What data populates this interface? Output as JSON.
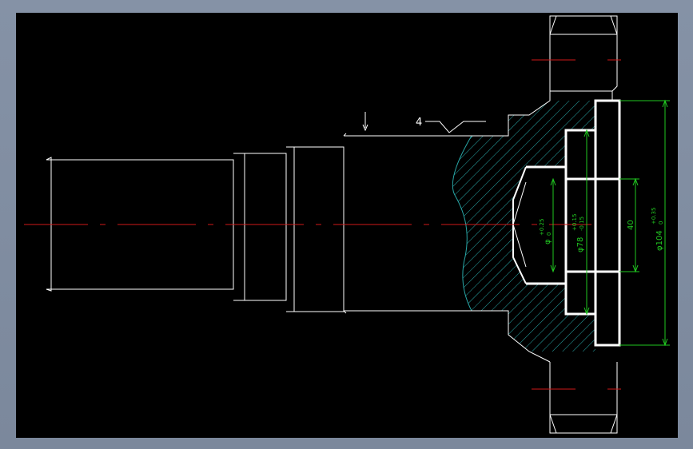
{
  "colors": {
    "background": "#000000",
    "outline": "#ffffff",
    "centerline": "#d01919",
    "dimension": "#21c821",
    "hatch": "#29a7a7",
    "frame": "#8592a6"
  },
  "annotations": {
    "surface_mark": "4"
  },
  "dimensions": {
    "d1_main": "φ",
    "d1_upper": "+0.25",
    "d1_lower": "0",
    "d2_main": "φ78",
    "d2_upper": "+0.15",
    "d2_lower": "-0.15",
    "d3_main": "40",
    "d4_main": "φ104",
    "d4_upper": "+0.35",
    "d4_lower": "0"
  }
}
